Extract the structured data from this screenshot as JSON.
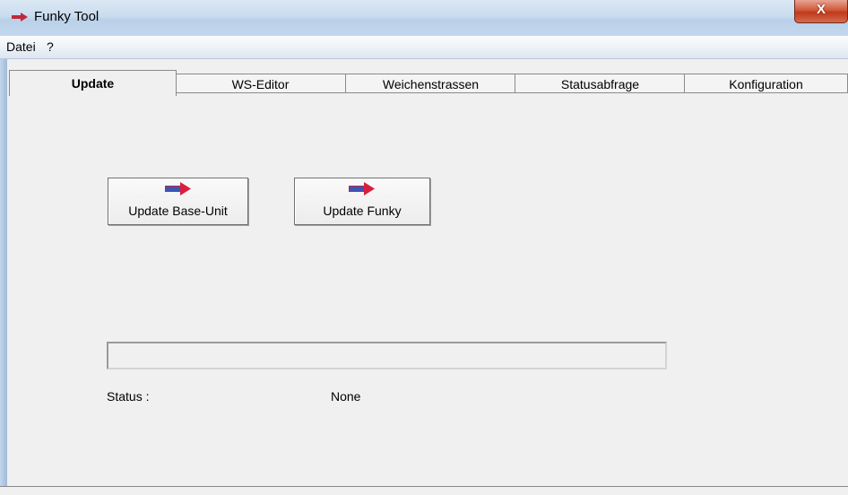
{
  "window": {
    "title": "Funky Tool",
    "close_glyph": "X",
    "app_icon": "arrow-icon",
    "accent_color": "#c0283c"
  },
  "menu": {
    "items": [
      {
        "label": "Datei"
      },
      {
        "label": "?"
      }
    ]
  },
  "tabs": [
    {
      "label": "Update",
      "active": true
    },
    {
      "label": "WS-Editor",
      "active": false
    },
    {
      "label": "Weichenstrassen",
      "active": false
    },
    {
      "label": "Statusabfrage",
      "active": false
    },
    {
      "label": "Konfiguration",
      "active": false
    }
  ],
  "update_panel": {
    "buttons": [
      {
        "label": "Update Base-Unit",
        "icon": "arrow-icon"
      },
      {
        "label": "Update Funky",
        "icon": "arrow-icon"
      }
    ],
    "progress": 0,
    "status_label": "Status :",
    "status_value": "None"
  }
}
